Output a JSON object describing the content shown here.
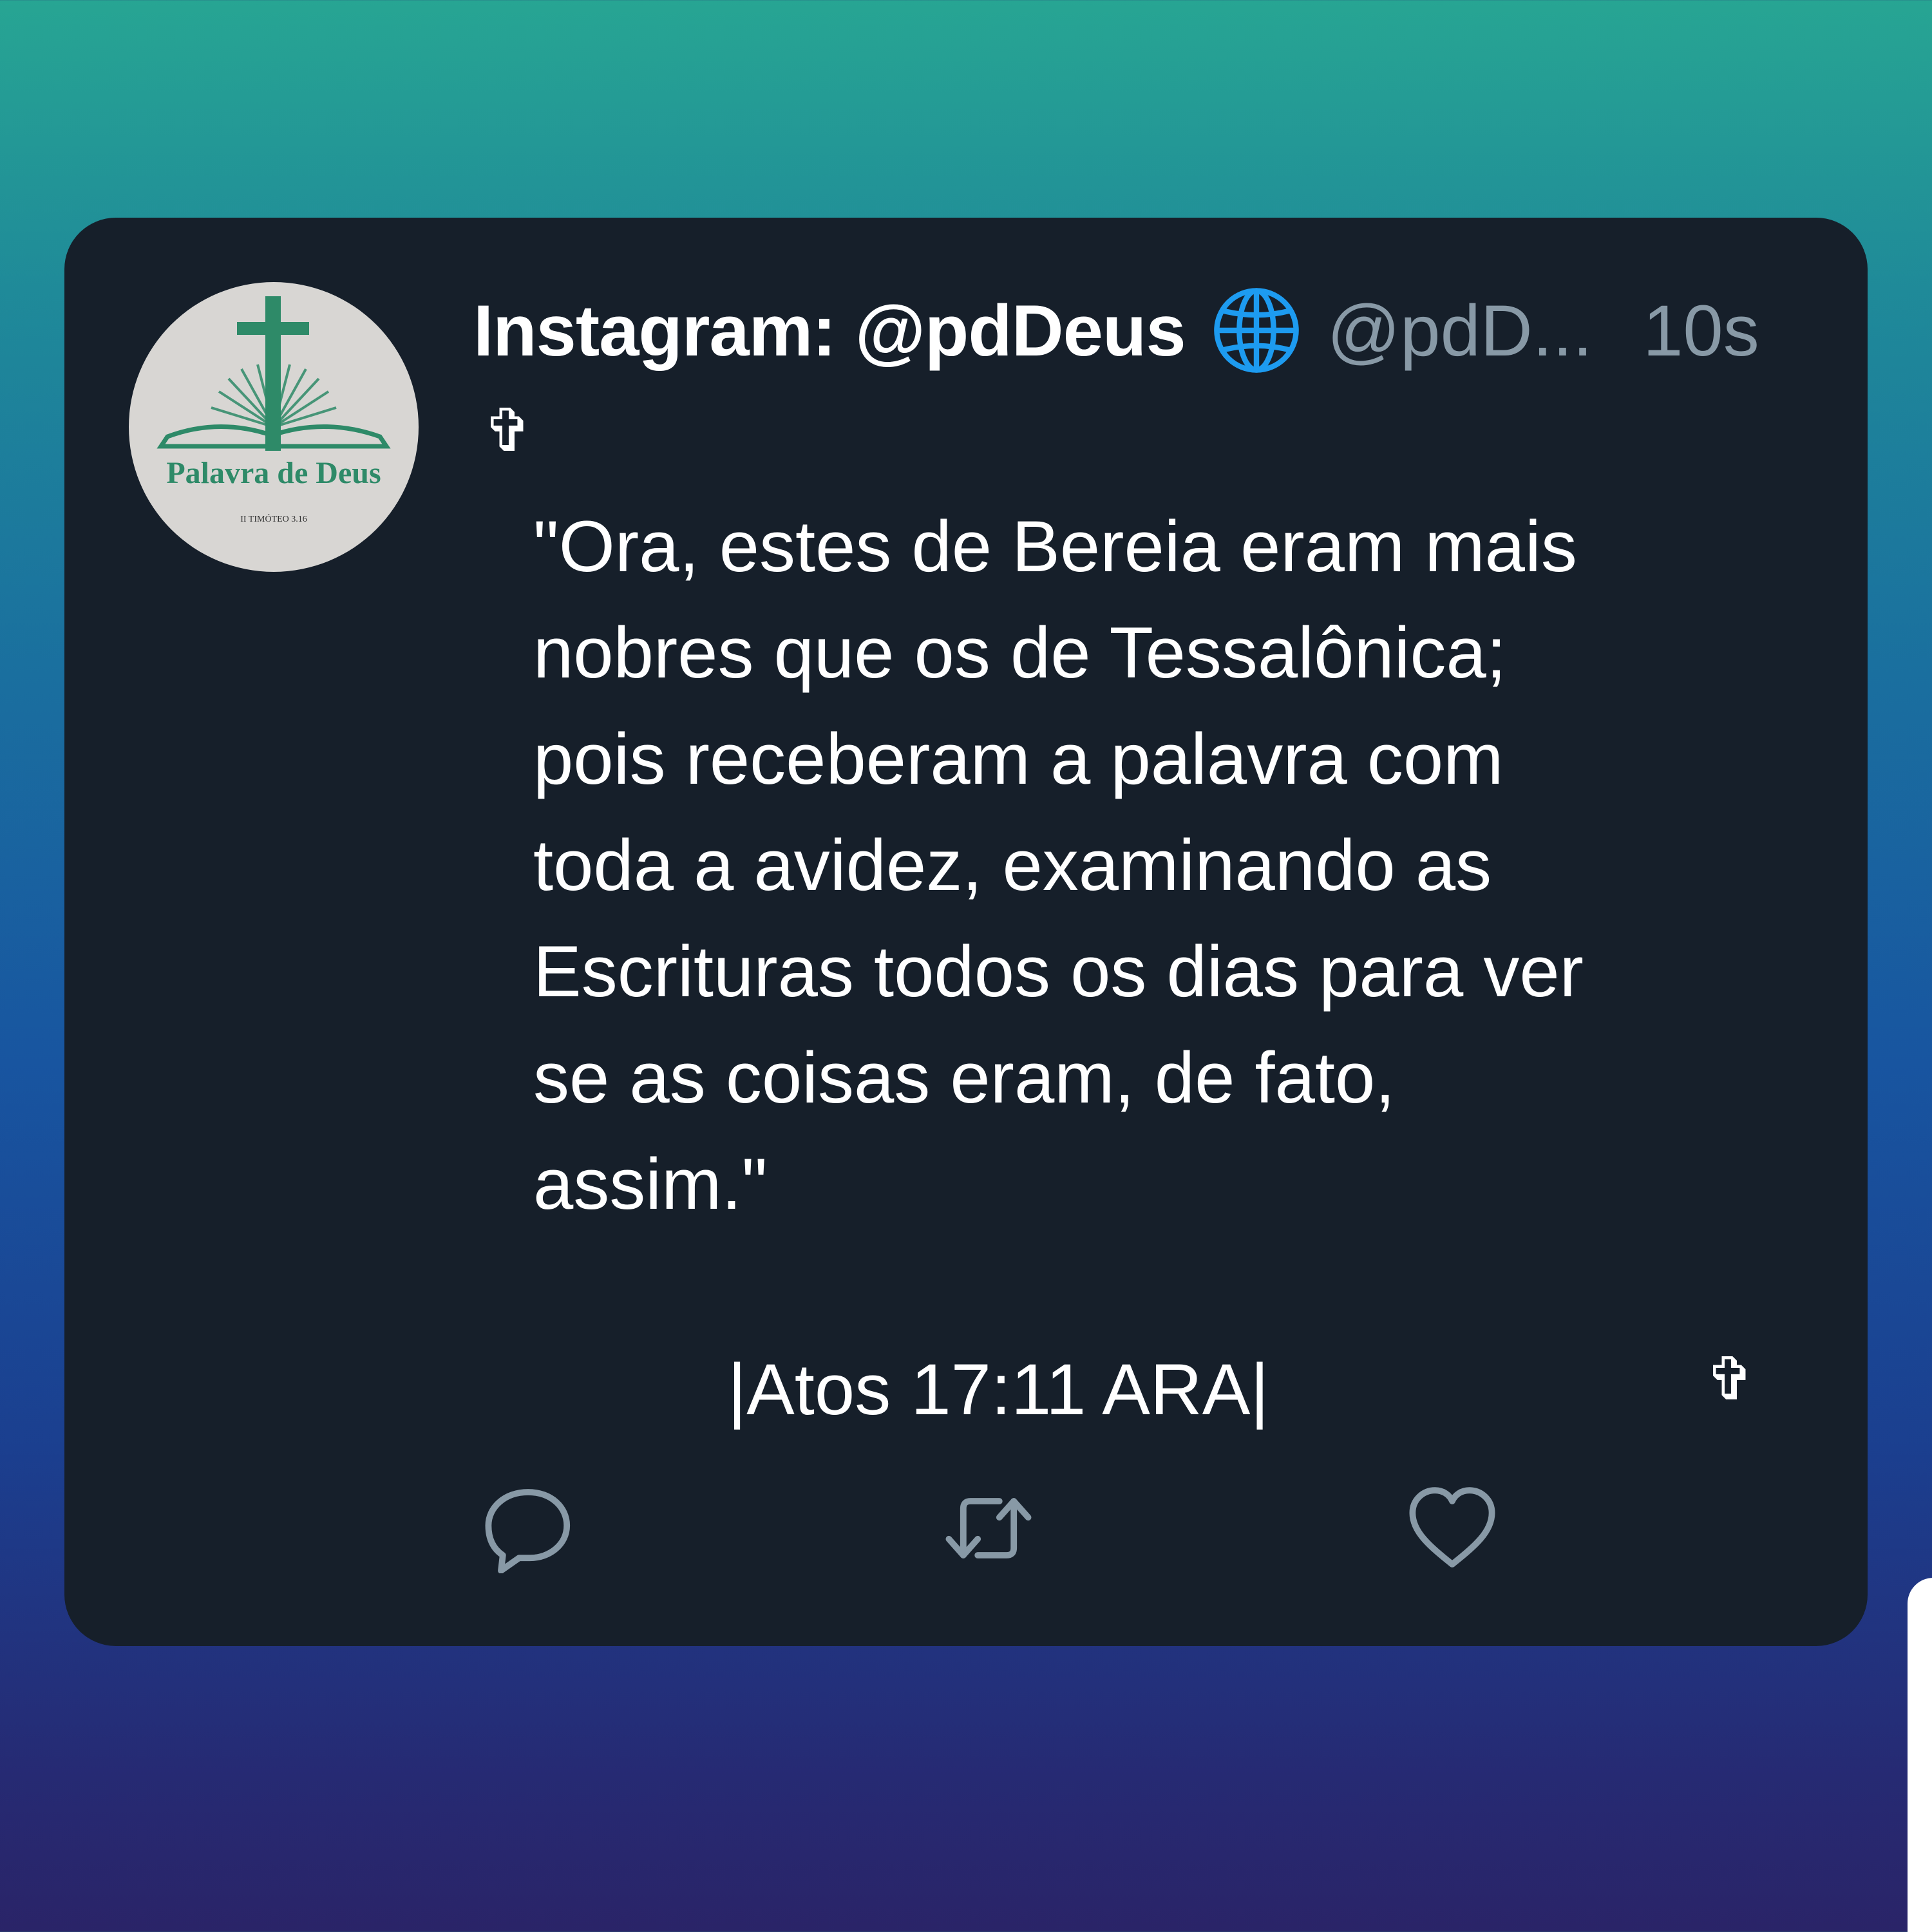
{
  "tweet": {
    "display_name": "Instagram: @pdDeus",
    "handle": "@pdD...",
    "timestamp": "10s",
    "cross_symbol": "✞",
    "text": "\"Ora, estes de Bereia eram mais\nnobres que os de Tessalônica;\npois receberam a palavra com\ntoda a avidez, examinando as\nEscrituras todos os dias para ver\nse as coisas eram, de fato,\nassim.\"",
    "reference": "|Atos 17:11 ARA|"
  },
  "avatar": {
    "logo_text": "Palavra de Deus",
    "logo_subtext": "II TIMÓTEO 3.16",
    "logo_color": "#2e8a68"
  },
  "actions": [
    {
      "name": "reply",
      "icon": "reply-icon"
    },
    {
      "name": "retweet",
      "icon": "retweet-icon"
    },
    {
      "name": "like",
      "icon": "heart-icon"
    }
  ],
  "colors": {
    "card_background": "#161f2a",
    "primary_text": "#ffffff",
    "secondary_text": "#8899a6",
    "globe_accent": "#1d9bf0"
  }
}
